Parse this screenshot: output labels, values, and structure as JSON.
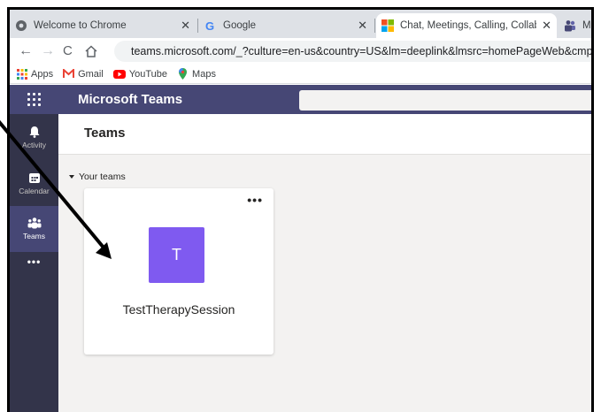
{
  "browser": {
    "tabs": [
      {
        "title": "Welcome to Chrome",
        "icon": "chrome-icon",
        "close": "✕"
      },
      {
        "title": "Google",
        "icon": "google-icon",
        "close": "✕"
      },
      {
        "title": "Chat, Meetings, Calling, Collabor",
        "icon": "microsoft-icon",
        "close": "✕"
      },
      {
        "title": "Mi",
        "icon": "teams-icon"
      }
    ],
    "url": "teams.microsoft.com/_?culture=en-us&country=US&lm=deeplink&lmsrc=homePageWeb&cmpid",
    "bookmarks": [
      {
        "label": "Apps",
        "icon": "apps-grid-icon"
      },
      {
        "label": "Gmail",
        "icon": "gmail-icon"
      },
      {
        "label": "YouTube",
        "icon": "youtube-icon"
      },
      {
        "label": "Maps",
        "icon": "maps-icon"
      }
    ]
  },
  "teams": {
    "app_title": "Microsoft Teams",
    "rail": [
      {
        "label": "Activity",
        "icon": "bell-icon"
      },
      {
        "label": "Calendar",
        "icon": "calendar-icon"
      },
      {
        "label": "Teams",
        "icon": "teams-people-icon",
        "active": true
      }
    ],
    "more_apps": "•••",
    "page_title": "Teams",
    "section_label": "Your teams",
    "cards": [
      {
        "initial": "T",
        "name": "TestTherapySession",
        "more": "•••",
        "color": "#7f5af0"
      }
    ]
  },
  "colors": {
    "header": "#464775",
    "rail": "#33344a",
    "avatar": "#7f5af0",
    "annotation_arrow": "#000000"
  }
}
